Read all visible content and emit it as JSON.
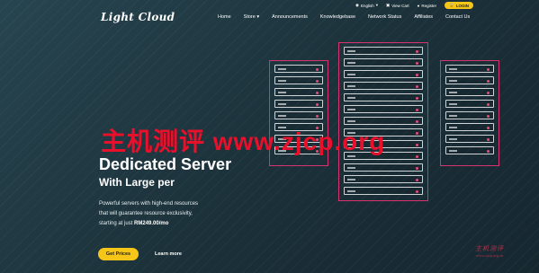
{
  "logo": "Light Cloud",
  "utility": {
    "language": "English",
    "cart": "View Cart",
    "register": "Register",
    "login": "LOGIN"
  },
  "nav": [
    "Home",
    "Store",
    "Announcements",
    "Knowledgebase",
    "Network Status",
    "Affiliates",
    "Contact Us"
  ],
  "watermark": "主机测评 www.zjcp.org",
  "hero": {
    "title": "Dedicated Server",
    "subtitle": "With Large per",
    "desc_lines": [
      "Powerful servers with high-end resources",
      "that will guarantee resource exclusivity,"
    ],
    "price_prefix": "starting at just ",
    "price": "RM249.00/mo",
    "cta": "Get Prices",
    "learn_more": "Learn more"
  },
  "corner": {
    "cn": "主机测评",
    "url": "www.zjcp.org.cn"
  },
  "colors": {
    "accent": "#f5c518",
    "rack_border": "#d9336f",
    "watermark": "#e8102a",
    "background": "#1e3640"
  }
}
